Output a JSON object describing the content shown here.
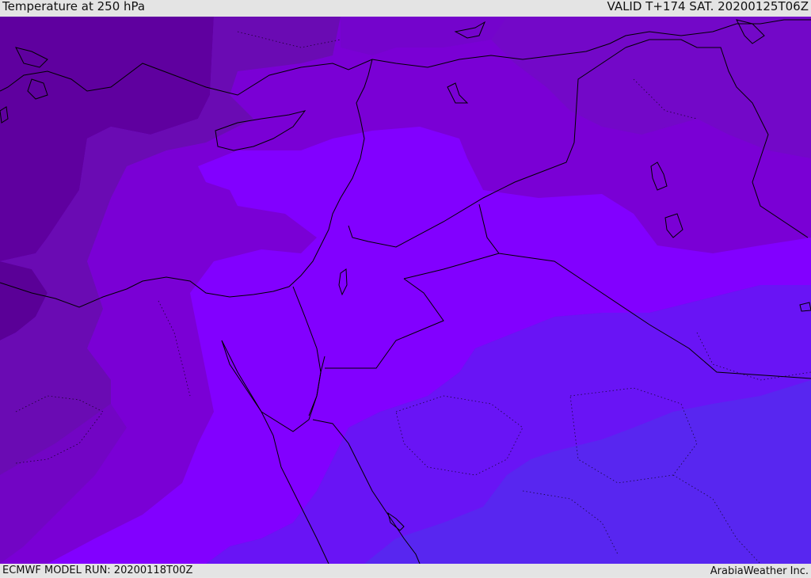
{
  "header": {
    "title": "Temperature at 250 hPa",
    "valid_time": "VALID T+174 SAT. 20200125T06Z"
  },
  "footer": {
    "model_run": "ECMWF MODEL RUN: 20200118T00Z",
    "credit": "ArabiaWeather Inc."
  },
  "map": {
    "field": "temperature",
    "level": "250 hPa",
    "colors": {
      "coldest_dark": "#5a0097",
      "dark": "#6500a8",
      "mid_dark": "#6f0fb8",
      "mid": "#7a00d5",
      "mid_light": "#8000f5",
      "violet": "#8200ff",
      "blue_violet": "#6914f5",
      "blue": "#5826f0",
      "lines": "#000000"
    }
  }
}
